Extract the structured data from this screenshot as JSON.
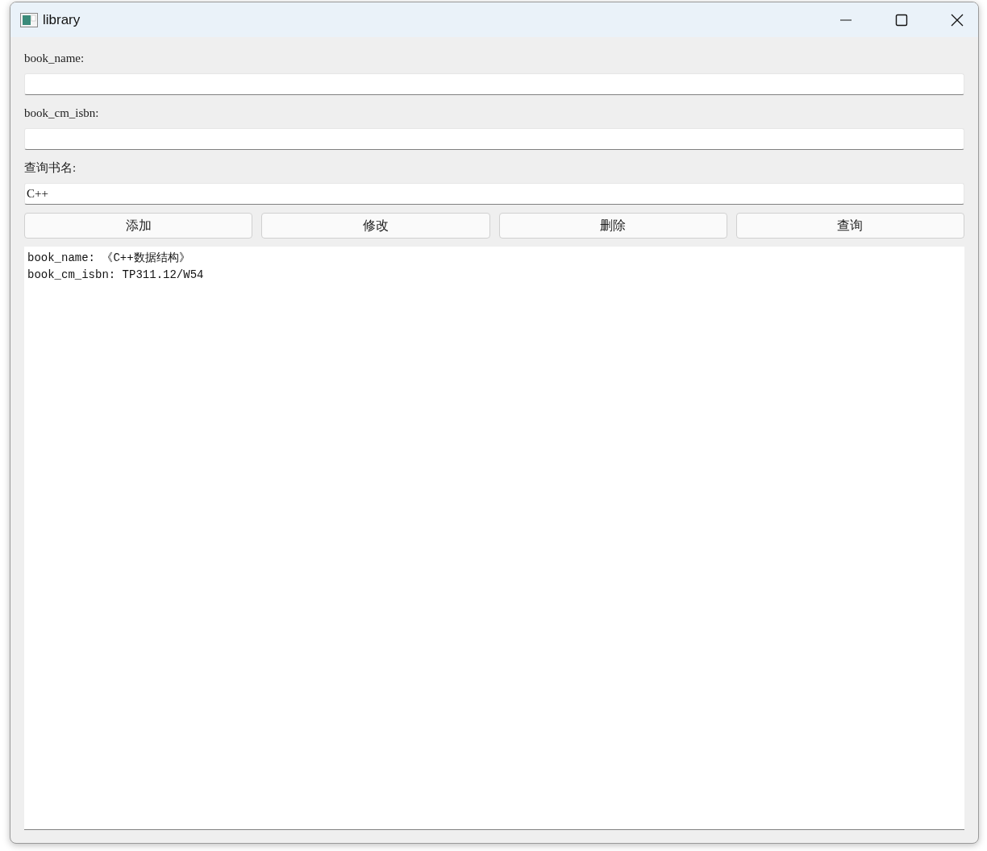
{
  "window": {
    "title": "library"
  },
  "fields": [
    {
      "label": "book_name:"
    },
    {
      "label": "book_cm_isbn:"
    },
    {
      "label": "查询书名:",
      "value": "C++"
    }
  ],
  "buttons": [
    "添加",
    "修改",
    "删除",
    "查询"
  ],
  "output": {
    "lines": [
      "book_name: 《C++数据结构》",
      "book_cm_isbn: TP311.12/W54"
    ]
  }
}
